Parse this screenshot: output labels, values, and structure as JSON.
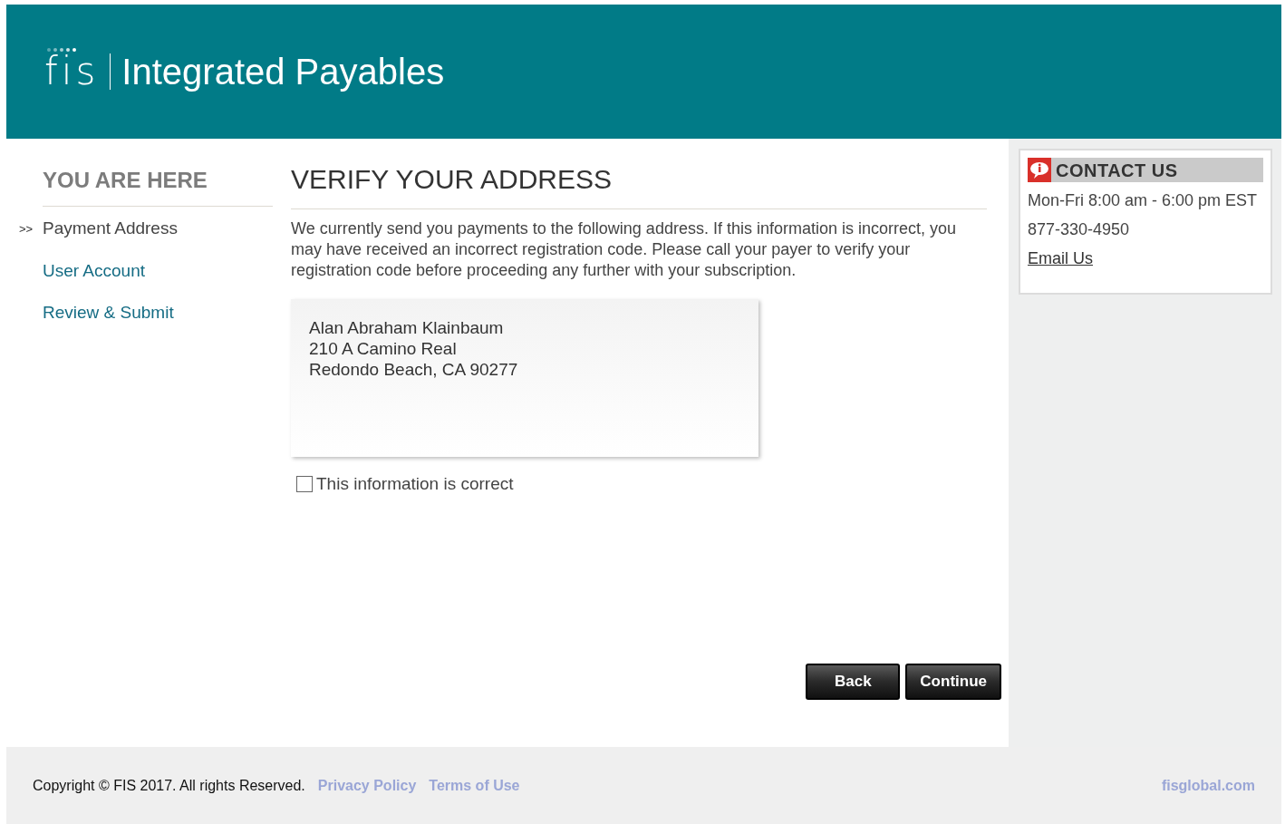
{
  "header": {
    "logo": "fis",
    "title": "Integrated Payables"
  },
  "sidebar": {
    "heading": "YOU ARE HERE",
    "current_marker": ">>",
    "items": [
      {
        "label": "Payment Address",
        "selected": true
      },
      {
        "label": "User Account",
        "selected": false
      },
      {
        "label": "Review & Submit",
        "selected": false
      }
    ]
  },
  "main": {
    "title": "VERIFY YOUR ADDRESS",
    "intro": "We currently send you payments to the following address. If this information is incorrect, you may have received an incorrect registration code. Please call your payer to verify your registration code before proceeding any further with your subscription.",
    "address": [
      "Alan Abraham Klainbaum",
      "210 A Camino Real",
      "Redondo Beach, CA 90277"
    ],
    "confirm": {
      "label": "This information is correct",
      "checked": false
    },
    "buttons": [
      "Back",
      "Continue"
    ]
  },
  "contact": {
    "title": "CONTACT US",
    "hours": "Mon-Fri 8:00 am - 6:00 pm EST",
    "phone": "877-330-4950",
    "email_link": "Email Us"
  },
  "footer": {
    "copyright": "Copyright © FIS 2017. All rights Reserved.",
    "links": [
      "Privacy Policy",
      "Terms of Use"
    ],
    "site": "fisglobal.com"
  }
}
